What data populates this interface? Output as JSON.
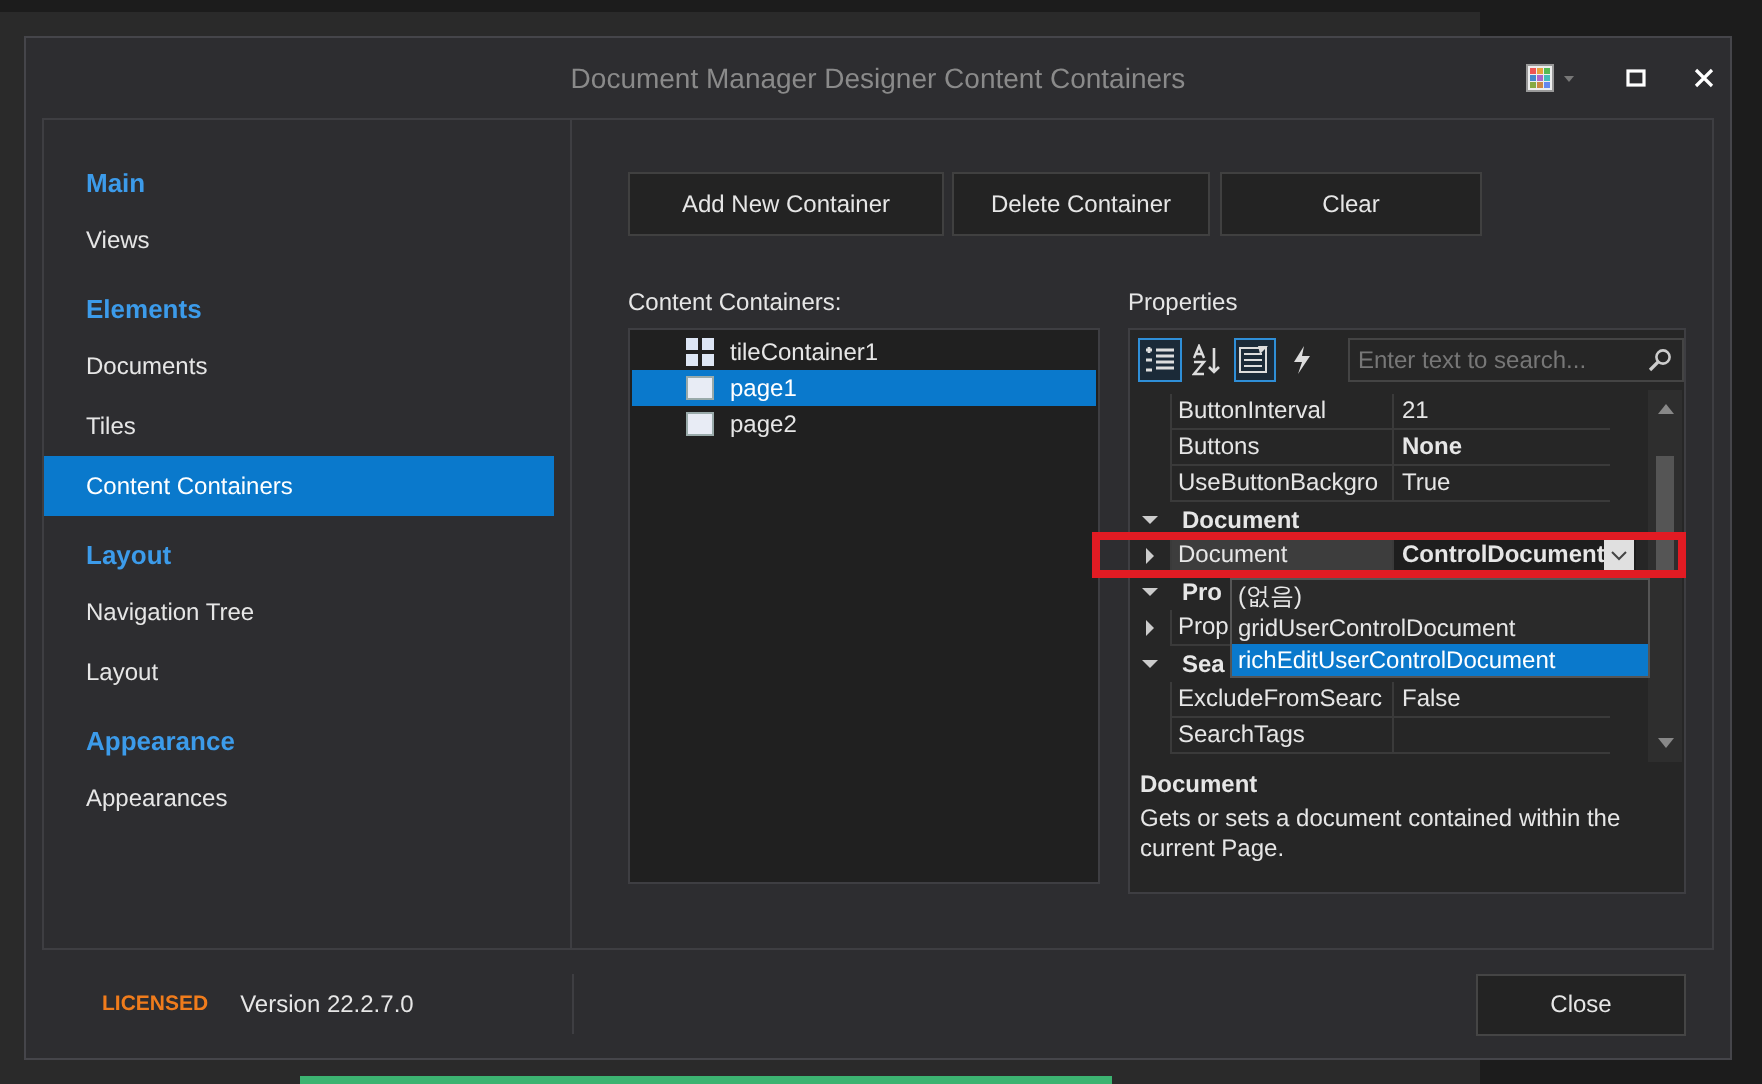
{
  "window": {
    "title": "Document Manager Designer Content Containers"
  },
  "sidebar": {
    "groups": [
      {
        "title": "Main",
        "items": [
          {
            "label": "Views",
            "selected": false
          }
        ]
      },
      {
        "title": "Elements",
        "items": [
          {
            "label": "Documents",
            "selected": false
          },
          {
            "label": "Tiles",
            "selected": false
          },
          {
            "label": "Content Containers",
            "selected": true
          }
        ]
      },
      {
        "title": "Layout",
        "items": [
          {
            "label": "Navigation Tree",
            "selected": false
          },
          {
            "label": "Layout",
            "selected": false
          }
        ]
      },
      {
        "title": "Appearance",
        "items": [
          {
            "label": "Appearances",
            "selected": false
          }
        ]
      }
    ]
  },
  "buttons": [
    "Add New Container",
    "Delete Container",
    "Clear"
  ],
  "containers": {
    "label": "Content Containers:",
    "items": [
      {
        "label": "tileContainer1",
        "kind": "tile",
        "selected": false
      },
      {
        "label": "page1",
        "kind": "page",
        "selected": true
      },
      {
        "label": "page2",
        "kind": "page",
        "selected": false
      }
    ]
  },
  "properties": {
    "label": "Properties",
    "search": {
      "placeholder": "Enter text to search..."
    },
    "toolbar": [
      {
        "kind": "categorized",
        "selected": true
      },
      {
        "kind": "alphabetical",
        "selected": false
      },
      {
        "kind": "pages",
        "selected": true
      },
      {
        "kind": "events",
        "selected": false
      }
    ],
    "rows": [
      {
        "kind": "property",
        "name": "ButtonInterval",
        "value": "21",
        "bold": false,
        "expanded": null
      },
      {
        "kind": "property",
        "name": "Buttons",
        "value": "None",
        "bold": true,
        "expanded": null
      },
      {
        "kind": "property",
        "name": "UseButtonBackgro",
        "value": "True",
        "bold": false,
        "expanded": null
      },
      {
        "kind": "category",
        "name": "Document",
        "expanded": true
      },
      {
        "kind": "editing",
        "name": "Document",
        "value": "ControlDocument",
        "bold": true,
        "expanded": false
      },
      {
        "kind": "category",
        "name": "Pro",
        "expanded": true
      },
      {
        "kind": "property",
        "name": "Prop",
        "expanded": false
      },
      {
        "kind": "category",
        "name": "Sea",
        "expanded": true
      },
      {
        "kind": "property",
        "name": "ExcludeFromSearc",
        "value": "False",
        "bold": false,
        "expanded": null
      },
      {
        "kind": "property",
        "name": "SearchTags",
        "expanded": null
      }
    ],
    "dropdown": [
      {
        "label": "(없음)",
        "selected": false
      },
      {
        "label": "gridUserControlDocument",
        "selected": false
      },
      {
        "label": "richEditUserControlDocument",
        "selected": true
      }
    ],
    "description": {
      "title": "Document",
      "text": "Gets or sets a document contained within the current Page."
    }
  },
  "footer": {
    "license": "LICENSED",
    "version": "Version 22.2.7.0",
    "close": "Close"
  }
}
